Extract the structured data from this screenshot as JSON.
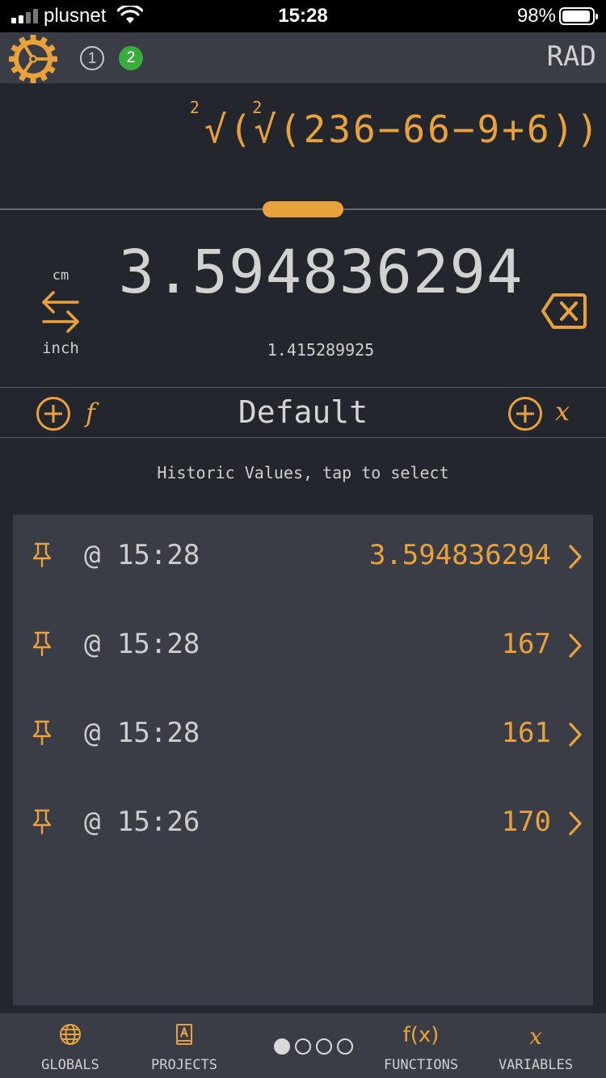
{
  "status_bar": {
    "carrier": "plusnet",
    "time": "15:28",
    "battery": "98%",
    "battery_level": 0.98
  },
  "top_bar": {
    "badges": [
      "1",
      "2"
    ],
    "angle_mode": "RAD",
    "icon": "gear-icon"
  },
  "expression": {
    "outer_root_index": "2",
    "inner_root_index": "2",
    "text_part1": "√(",
    "text_part2": "√(236−66−9+6))"
  },
  "result": {
    "value": "3.594836294",
    "secondary": "1.415289925",
    "unit_from": "cm",
    "unit_to": "inch"
  },
  "project": {
    "name": "Default",
    "add_function_label": "f",
    "add_variable_label": "x"
  },
  "history": {
    "caption": "Historic Values, tap to select",
    "items": [
      {
        "time": "@ 15:28",
        "value": "3.594836294"
      },
      {
        "time": "@ 15:28",
        "value": "167"
      },
      {
        "time": "@ 15:28",
        "value": "161"
      },
      {
        "time": "@ 15:26",
        "value": "170"
      }
    ]
  },
  "tab_bar": {
    "globals": "GLOBALS",
    "projects": "PROJECTS",
    "functions": "FUNCTIONS",
    "functions_icon_text": "f(x)",
    "variables": "VARIABLES",
    "variables_icon_text": "x",
    "page_count": 4,
    "active_page": 1
  },
  "colors": {
    "accent": "#e9a23b",
    "background": "#23262d",
    "panel": "#3a3d46",
    "badge_green": "#3aab3c"
  }
}
